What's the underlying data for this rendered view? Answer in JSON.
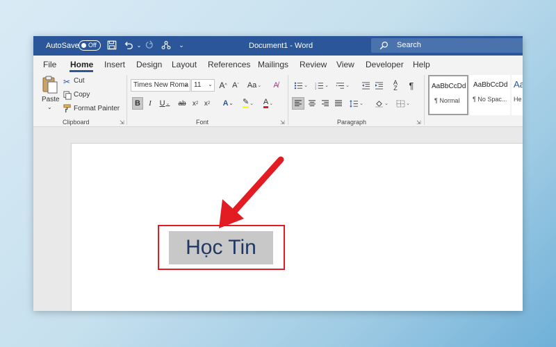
{
  "titlebar": {
    "autosave_label": "AutoSave",
    "autosave_state": "Off",
    "document_title": "Document1 - Word",
    "search_placeholder": "Search",
    "bg_color": "#2b579a"
  },
  "menu": {
    "tabs": [
      "File",
      "Home",
      "Insert",
      "Design",
      "Layout",
      "References",
      "Mailings",
      "Review",
      "View",
      "Developer",
      "Help"
    ],
    "active": "Home"
  },
  "ribbon": {
    "clipboard": {
      "paste_label": "Paste",
      "cut_label": "Cut",
      "copy_label": "Copy",
      "format_painter_label": "Format Painter",
      "group_label": "Clipboard"
    },
    "font": {
      "font_name": "Times New Roma",
      "font_size": "11",
      "group_label": "Font",
      "change_case": "Aa"
    },
    "paragraph": {
      "group_label": "Paragraph",
      "pilcrow": "¶"
    },
    "styles": [
      {
        "sample": "AaBbCcDd",
        "name": "¶ Normal"
      },
      {
        "sample": "AaBbCcDd",
        "name": "¶ No Spac..."
      },
      {
        "sample": "Aa",
        "name": "He"
      }
    ]
  },
  "document": {
    "selected_text": "Học Tin",
    "highlight_color": "#e31b23"
  }
}
